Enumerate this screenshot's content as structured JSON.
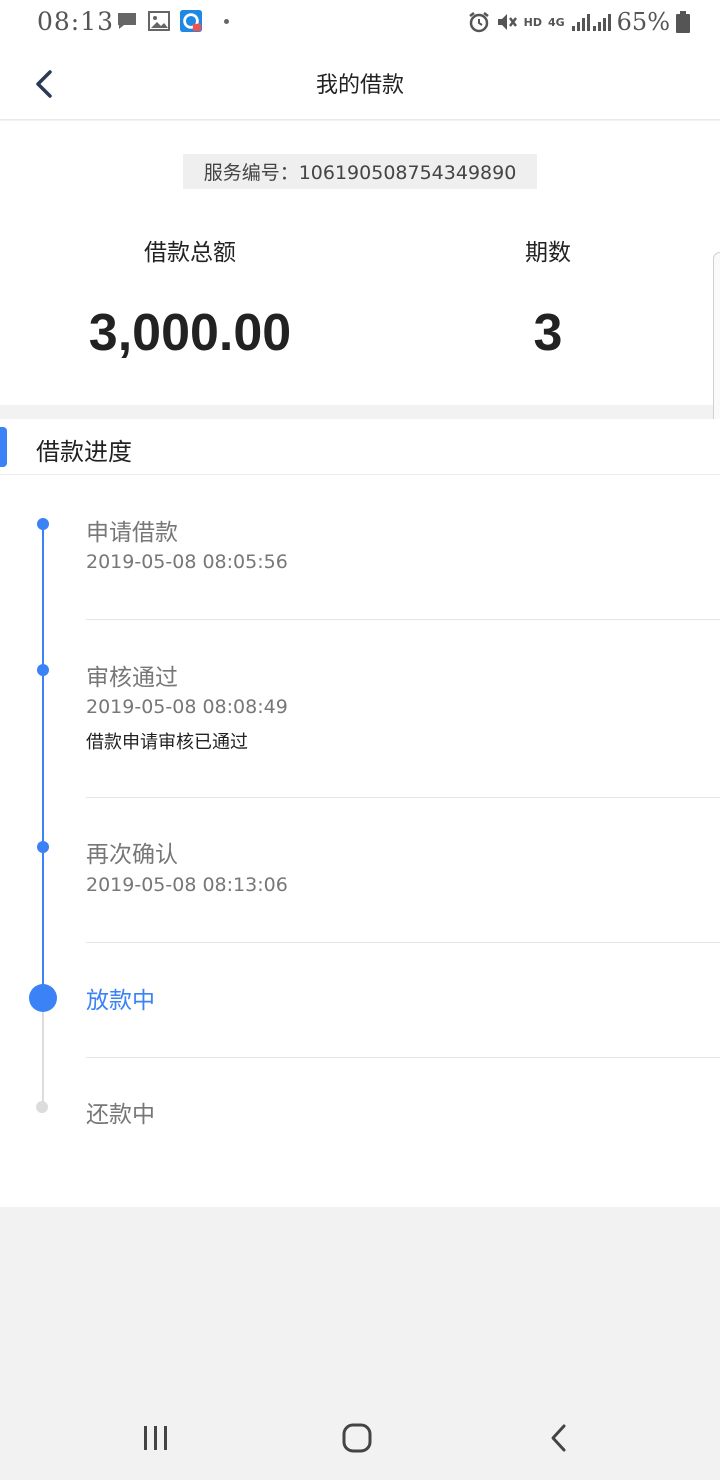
{
  "status_bar": {
    "time": "08:13",
    "network": "4G",
    "hd": "HD",
    "battery": "65%",
    "icons": [
      "message-icon",
      "image-icon",
      "app-notification-icon",
      "alarm-icon",
      "mute-icon",
      "signal-icon",
      "battery-icon"
    ]
  },
  "header": {
    "title": "我的借款",
    "back_icon": "chevron-left-icon"
  },
  "summary": {
    "service_number": "服务编号：106190508754349890",
    "amount_label": "借款总额",
    "amount_value": "3,000.00",
    "periods_label": "期数",
    "periods_value": "3"
  },
  "progress": {
    "title": "借款进度",
    "accent_color": "#3b82f6",
    "steps": [
      {
        "title": "申请借款",
        "time": "2019-05-08 08:05:56",
        "note": "",
        "state": "done"
      },
      {
        "title": "审核通过",
        "time": "2019-05-08 08:08:49",
        "note": "借款申请审核已通过",
        "state": "done"
      },
      {
        "title": "再次确认",
        "time": "2019-05-08 08:13:06",
        "note": "",
        "state": "done"
      },
      {
        "title": "放款中",
        "time": "",
        "note": "",
        "state": "current"
      },
      {
        "title": "还款中",
        "time": "",
        "note": "",
        "state": "pending"
      }
    ]
  },
  "nav_bar": {
    "buttons": [
      "recent-apps-icon",
      "home-icon",
      "back-icon"
    ]
  }
}
